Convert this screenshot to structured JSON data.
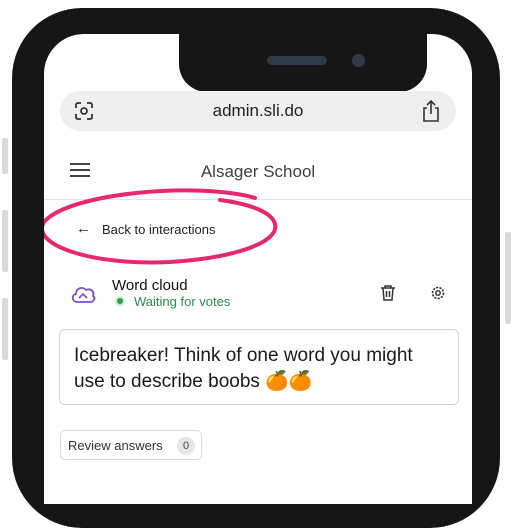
{
  "browser": {
    "url": "admin.sli.do",
    "icons": {
      "left": "lens-icon",
      "right": "share-icon"
    }
  },
  "header": {
    "menu_icon": "hamburger-icon",
    "title": "Alsager School"
  },
  "back_link": {
    "label": "Back to interactions",
    "icon": "arrow-left-icon",
    "highlight_color": "#e8286e"
  },
  "poll": {
    "type_label": "Word cloud",
    "status": "Waiting for votes",
    "status_color": "#2e9f57",
    "accent_color": "#7b4fc9",
    "actions": [
      "trash-icon",
      "gear-icon"
    ],
    "question": "Icebreaker! Think of one word you might use to describe boobs 🍊🍊"
  },
  "review": {
    "label": "Review answers",
    "count": "0"
  }
}
